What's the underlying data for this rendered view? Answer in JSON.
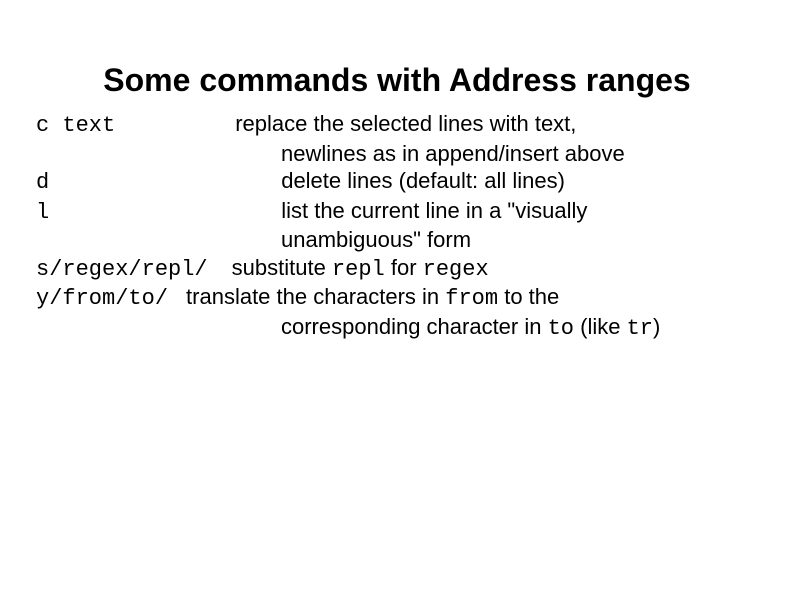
{
  "title": "Some commands with Address ranges",
  "commands": {
    "c": {
      "cmd": "c text",
      "desc1": "replace the selected lines with text,",
      "desc2": "newlines as in append/insert above"
    },
    "d": {
      "cmd": "d",
      "desc": "delete lines (default: all lines)"
    },
    "l": {
      "cmd": "l",
      "desc1": "list the current line in a \"visually",
      "desc2": "unambiguous\" form"
    },
    "s": {
      "cmd": "s/regex/repl/",
      "desc_pre": "substitute ",
      "repl_mono": "repl",
      "desc_mid": " for ",
      "regex_mono": "regex"
    },
    "y": {
      "cmd": "y/from/to/",
      "desc_pre": "translate the characters in ",
      "from_mono": "from",
      "desc_mid": " to the",
      "desc2_pre": "corresponding character in ",
      "to_mono": "to",
      "desc2_mid": " (like ",
      "tr_mono": "tr",
      "desc2_end": ")"
    }
  }
}
